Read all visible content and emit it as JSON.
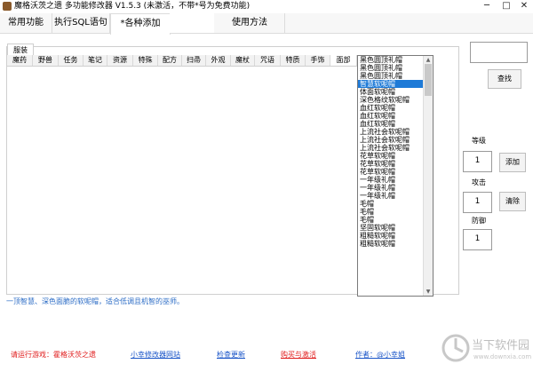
{
  "window": {
    "title": "魔格沃茨之遗  多功能修改器  V1.5.3  (未激活，不带*号为免费功能)",
    "minimize_label": "─",
    "maximize_label": "□",
    "close_label": "✕"
  },
  "tabs": [
    {
      "label": "常用功能"
    },
    {
      "label": "执行SQL语句"
    },
    {
      "label": "*各种添加"
    },
    {
      "label": "使用方法"
    }
  ],
  "subtab": {
    "label": "服装"
  },
  "categories": [
    "魔药",
    "野兽",
    "任务",
    "笔记",
    "资源",
    "特殊",
    "配方",
    "扫帚",
    "外观",
    "魔杖",
    "咒语",
    "特质",
    "手饰",
    "面部"
  ],
  "list_items": [
    "黑色圆顶礼帽",
    "黑色圆顶礼帽",
    "黑色圆顶礼帽",
    "智慧软呢帽",
    "体面软呢帽",
    "深色格纹软呢帽",
    "血红软呢帽",
    "血红软呢帽",
    "血红软呢帽",
    "上流社会软呢帽",
    "上流社会软呢帽",
    "上流社会软呢帽",
    "花草软呢帽",
    "花草软呢帽",
    "花草软呢帽",
    "一年级礼帽",
    "一年级礼帽",
    "一年级礼帽",
    "毛帽",
    "毛帽",
    "毛帽",
    "坚固软呢帽",
    "粗糙软呢帽",
    "粗糙软呢帽"
  ],
  "selected_index": 3,
  "description": "一顶智慧、深色面脆的软呢帽，适合低调且机智的巫师。",
  "right_panel": {
    "search_value": "",
    "search_button": "查找",
    "level_label": "等级",
    "level_value": "1",
    "add_button": "添加",
    "attack_label": "攻击",
    "attack_value": "1",
    "clear_button": "清除",
    "defense_label": "防御",
    "defense_value": "1"
  },
  "footer": {
    "game_link": "请运行游戏：霍格沃茨之遗",
    "site_link": "小幸修改器网站",
    "update_link": "检查更新",
    "buy_link": "购买与激活",
    "author_link": "作者：@小幸姐"
  },
  "watermark": {
    "text": "当下软件园",
    "url_text": "www.downxia.com"
  },
  "colors": {
    "link_blue": "#1a55c8",
    "link_red": "#e01b1b",
    "selection": "#1e7ad7",
    "description": "#2a6bc5"
  }
}
